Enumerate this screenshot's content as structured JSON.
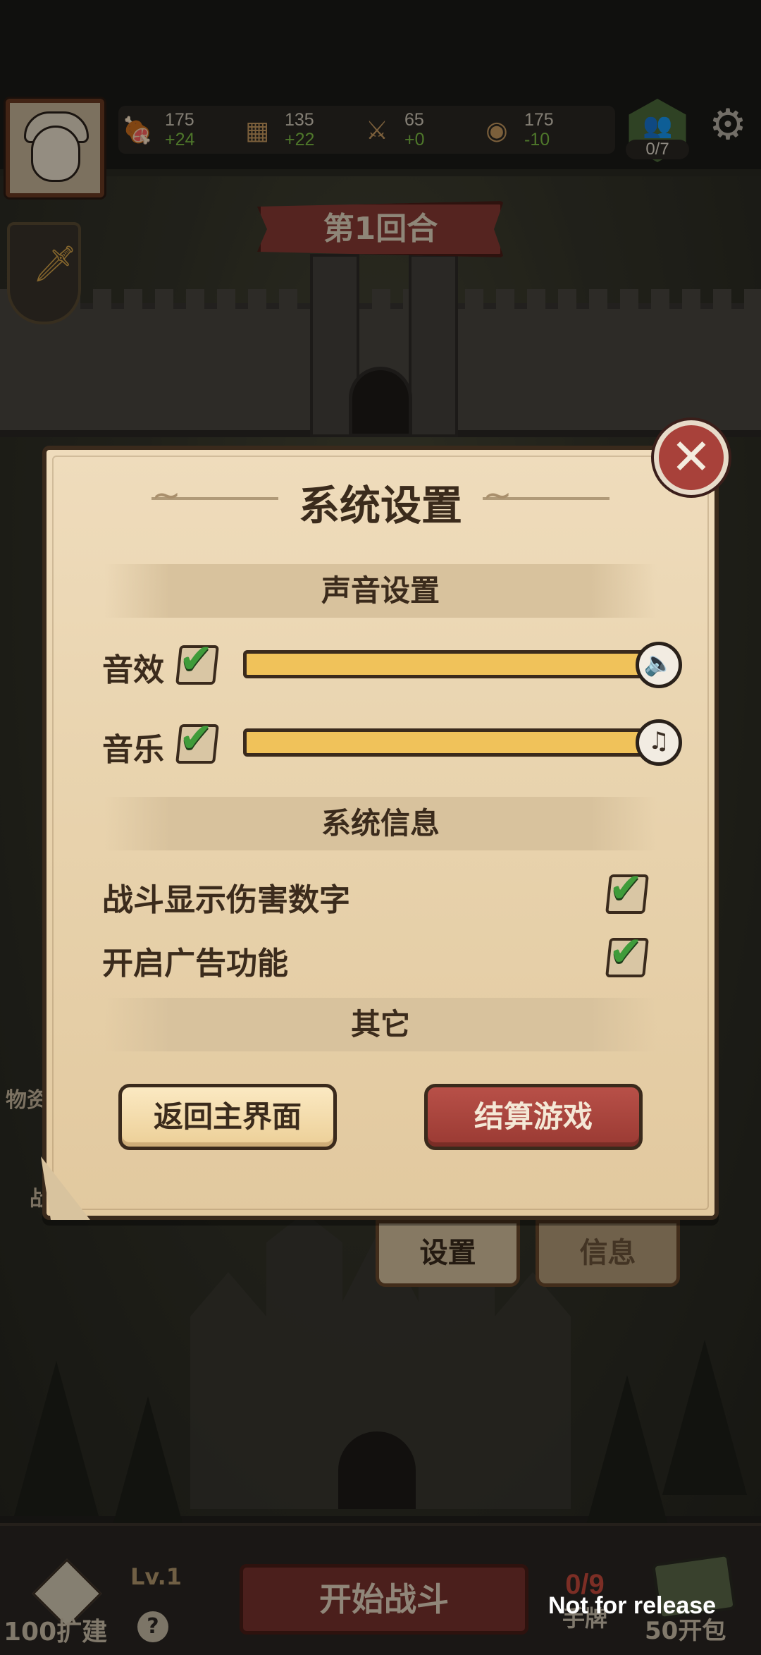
{
  "hud": {
    "resources": [
      {
        "icon": "meat-icon",
        "glyph": "🍖",
        "value": "175",
        "delta": "+24"
      },
      {
        "icon": "wood-icon",
        "glyph": "▦",
        "value": "135",
        "delta": "+22"
      },
      {
        "icon": "sword-icon",
        "glyph": "⚔",
        "value": "65",
        "delta": "+0"
      },
      {
        "icon": "coin-icon",
        "glyph": "◉",
        "value": "175",
        "delta": "-10"
      }
    ],
    "population": "0/7",
    "round": "第1回合"
  },
  "dialog": {
    "title": "系统设置",
    "sound_section": "声音设置",
    "sfx_label": "音效",
    "music_label": "音乐",
    "sfx_enabled": true,
    "music_enabled": true,
    "sfx_volume": 1.0,
    "music_volume": 1.0,
    "info_section": "系统信息",
    "damage_numbers_label": "战斗显示伤害数字",
    "damage_numbers_enabled": true,
    "ads_label": "开启广告功能",
    "ads_enabled": true,
    "other_section": "其它",
    "return_button": "返回主界面",
    "settle_button": "结算游戏",
    "close_glyph": "✕",
    "check_glyph": "✔",
    "sfx_glyph": "🔈",
    "music_glyph": "♫"
  },
  "menu_tabs": {
    "settings": "设置",
    "info": "信息"
  },
  "side_labels": {
    "left_top": "物资",
    "left_bottom": "战"
  },
  "bottom": {
    "level": "Lv.1",
    "expand": "100扩建",
    "help": "?",
    "start_battle": "开始战斗",
    "hand_count": "0/9",
    "hand_label": "手牌",
    "pack": "50开包",
    "watermark": "Not for release"
  },
  "colors": {
    "accent_red": "#a8413a",
    "slider_fill": "#f0c25a",
    "check_green": "#3f9b3a",
    "parchment": "#e9d4af"
  }
}
